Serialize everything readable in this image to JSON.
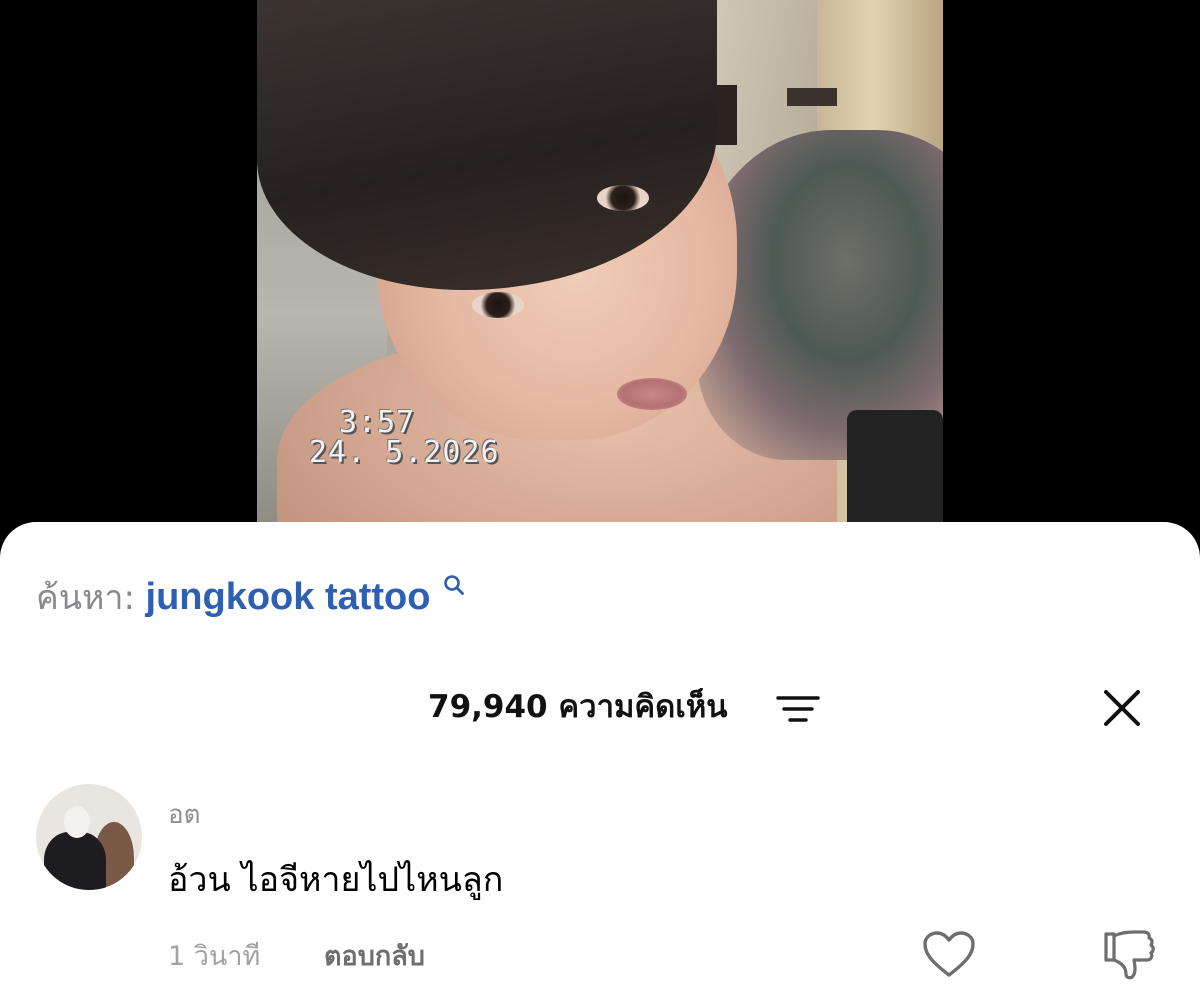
{
  "video": {
    "timestamp_time": "3:57",
    "timestamp_date": "24. 5.2026"
  },
  "search": {
    "prefix": "ค้นหา:",
    "query": "jungkook tattoo",
    "icon": "search-icon"
  },
  "comments_header": {
    "count_label": "79,940 ความคิดเห็น",
    "sort_icon": "sort-icon",
    "close_icon": "close-icon"
  },
  "comments": [
    {
      "author": "อต",
      "text": "อ้วน ไอจีหายไปไหนลูก",
      "time": "1 วินาที",
      "reply_label": "ตอบกลับ",
      "like_icon": "heart-icon",
      "dislike_icon": "thumbs-down-icon"
    }
  ],
  "colors": {
    "query": "#2f5fb3",
    "muted": "#8e8e93",
    "sheet_bg": "#ffffff",
    "backdrop": "#000000"
  }
}
